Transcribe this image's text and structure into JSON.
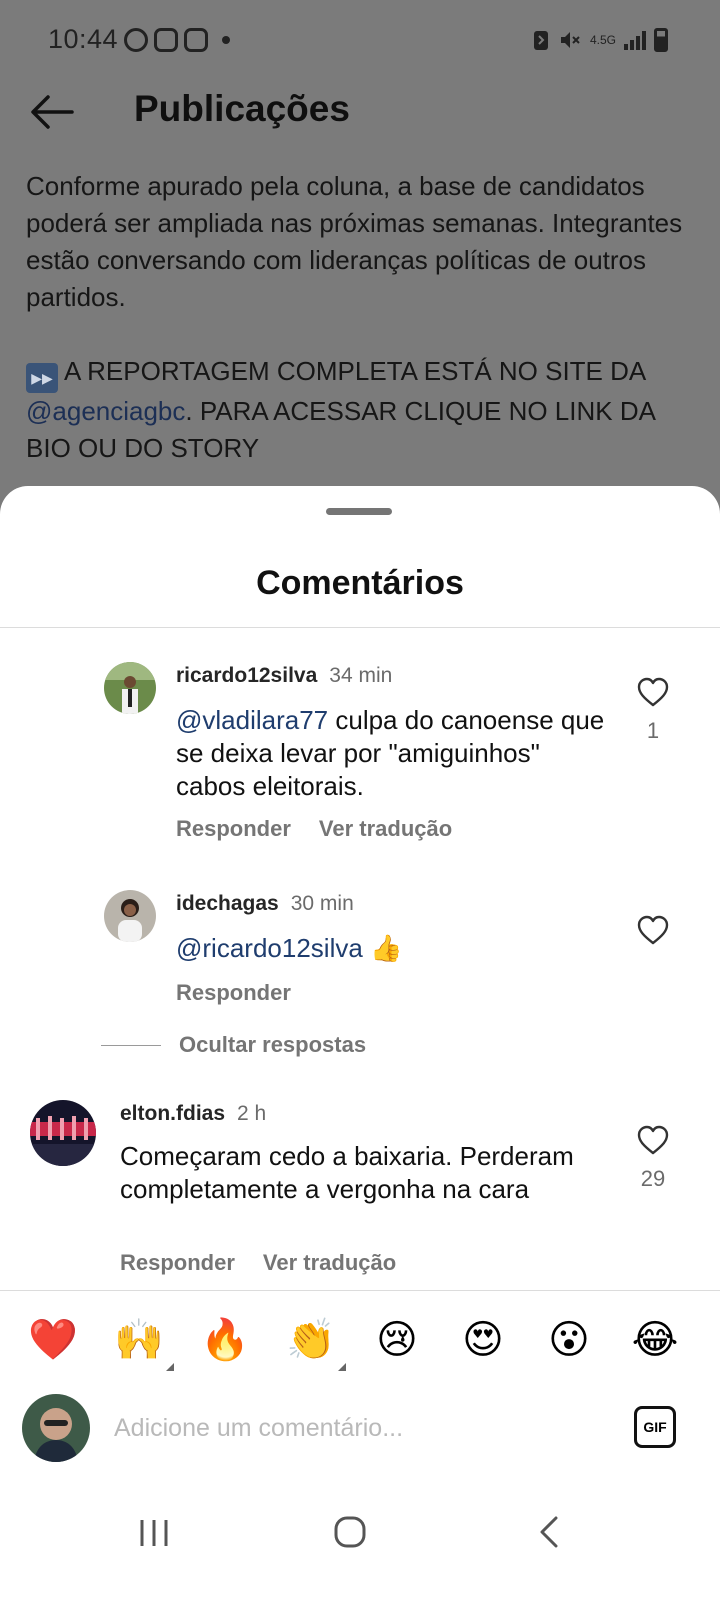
{
  "status_bar": {
    "time": "10:44",
    "network": "4.5G",
    "notification_icons": [
      "whatsapp-icon",
      "instagram-icon",
      "instagram-icon"
    ]
  },
  "app_bar": {
    "title": "Publicações"
  },
  "caption": {
    "paragraph": "Conforme apurado pela coluna, a base de candidatos poderá ser ampliada nas próximas semanas. Integrantes estão conversando com lideranças políticas de outros partidos.",
    "cta_part1": "A REPORTAGEM COMPLETA ESTÁ NO SITE DA",
    "cta_mention": "@agenciagbc",
    "cta_part2": ". PARA ACESSAR CLIQUE NO LINK DA BIO OU DO STORY"
  },
  "sheet": {
    "title": "Comentários"
  },
  "comments": [
    {
      "username": "ricardo12silva",
      "time": "34 min",
      "mention": "@vladilara77",
      "text": " culpa do canoense que se deixa levar por \"amiguinhos\" cabos eleitorais.",
      "likes": "1",
      "reply_label": "Responder",
      "translate_label": "Ver tradução"
    },
    {
      "username": "idechagas",
      "time": "30 min",
      "mention": "@ricardo12silva",
      "text": " 👍",
      "likes": "",
      "reply_label": "Responder"
    },
    {
      "username": "elton.fdias",
      "time": "2 h",
      "text": "Começaram cedo a baixaria. Perderam completamente a vergonha na cara",
      "likes": "29",
      "reply_label": "Responder",
      "translate_label": "Ver tradução"
    }
  ],
  "hide_replies_label": "Ocultar respostas",
  "emoji_reactions": [
    "❤️",
    "🙌",
    "🔥",
    "👏",
    "😢",
    "😍",
    "😮",
    "😂"
  ],
  "composer": {
    "placeholder": "Adicione um comentário...",
    "gif_label": "GIF"
  },
  "colors": {
    "mention": "#1f3d6e",
    "secondary_text": "#757575",
    "overlay": "#7b7b7b"
  }
}
